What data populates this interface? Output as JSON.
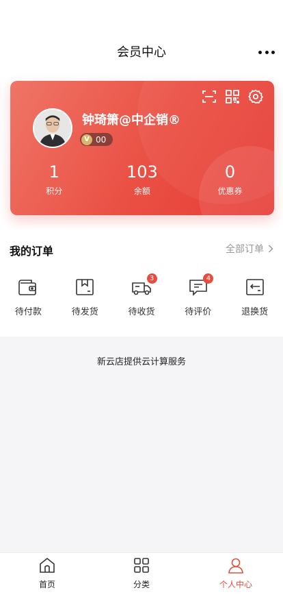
{
  "header": {
    "title": "会员中心",
    "more_icon": "more-dots-icon"
  },
  "member_card": {
    "username": "钟琦箫@中企销®",
    "level": "00",
    "icons": [
      "scan-icon",
      "qrcode-icon",
      "settings-gear-icon"
    ],
    "stats": [
      {
        "value": "1",
        "label": "积分"
      },
      {
        "value": "103",
        "label": "余额"
      },
      {
        "value": "0",
        "label": "优惠券"
      }
    ],
    "gradient_colors": [
      "#ef7566",
      "#e63d37"
    ]
  },
  "orders": {
    "title": "我的订单",
    "all_label": "全部订单",
    "items": [
      {
        "label": "待付款",
        "icon": "wallet-icon",
        "badge": ""
      },
      {
        "label": "待发货",
        "icon": "package-box-icon",
        "badge": ""
      },
      {
        "label": "待收货",
        "icon": "delivery-truck-icon",
        "badge": "3"
      },
      {
        "label": "待评价",
        "icon": "comment-icon",
        "badge": "4"
      },
      {
        "label": "退换货",
        "icon": "return-exchange-icon",
        "badge": ""
      }
    ]
  },
  "footer_note": "新云店提供云计算服务",
  "tabbar": {
    "items": [
      {
        "label": "首页",
        "icon": "home-icon",
        "active": false
      },
      {
        "label": "分类",
        "icon": "category-grid-icon",
        "active": false
      },
      {
        "label": "个人中心",
        "icon": "user-profile-icon",
        "active": true
      }
    ],
    "active_color": "#e74c3c"
  }
}
